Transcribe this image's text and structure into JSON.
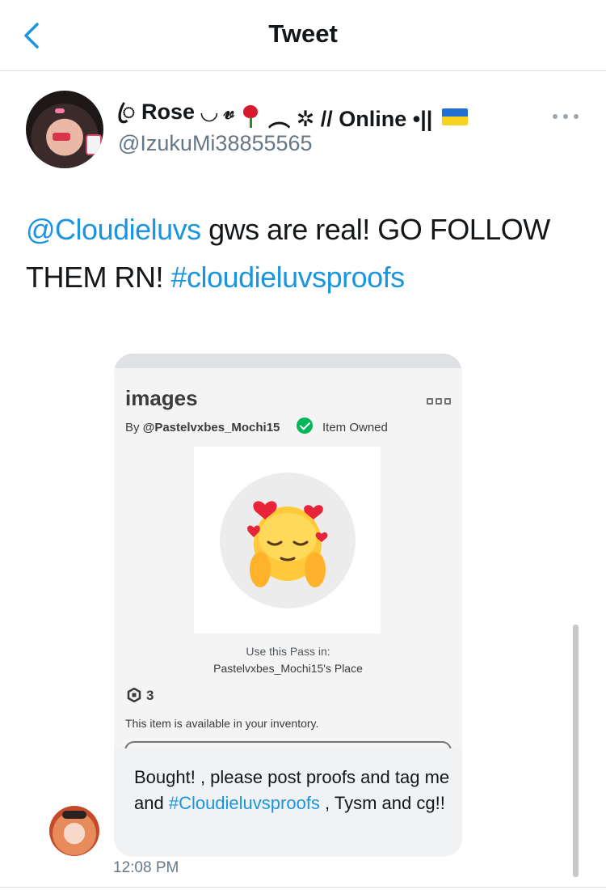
{
  "header": {
    "title": "Tweet",
    "back_icon": "chevron-left-icon"
  },
  "tweet": {
    "author_name_prefix": "ꦿ Rose ◡ 𝓋",
    "author_name_suffix": "︵ ✲ // Online •||",
    "author_handle": "@IzukuMi38855565",
    "text_mention": "@Cloudieluvs",
    "text_body": " gws are real! GO FOLLOW THEM RN! ",
    "text_hashtag": "#cloudieluvsproofs",
    "timestamp": "12:08 PM"
  },
  "card": {
    "item_title": "images",
    "by_prefix": "By ",
    "creator": "@Pastelvxbes_Mochi15",
    "owned_label": "Item Owned",
    "use_pass_label": "Use this Pass in:",
    "place_name": "Pastelvxbes_Mochi15's Place",
    "price": "3",
    "inventory_note": "This item is available in your inventory."
  },
  "reply_bubble": {
    "text_start": "Bought! , please post proofs and tag me and ",
    "hashtag": "#Cloudieluvsproofs",
    "text_end": " , Tysm and cg!!"
  },
  "colors": {
    "link": "#1b95e0",
    "owned_check": "#02b757",
    "text_primary": "#14171a",
    "text_secondary": "#657786"
  }
}
